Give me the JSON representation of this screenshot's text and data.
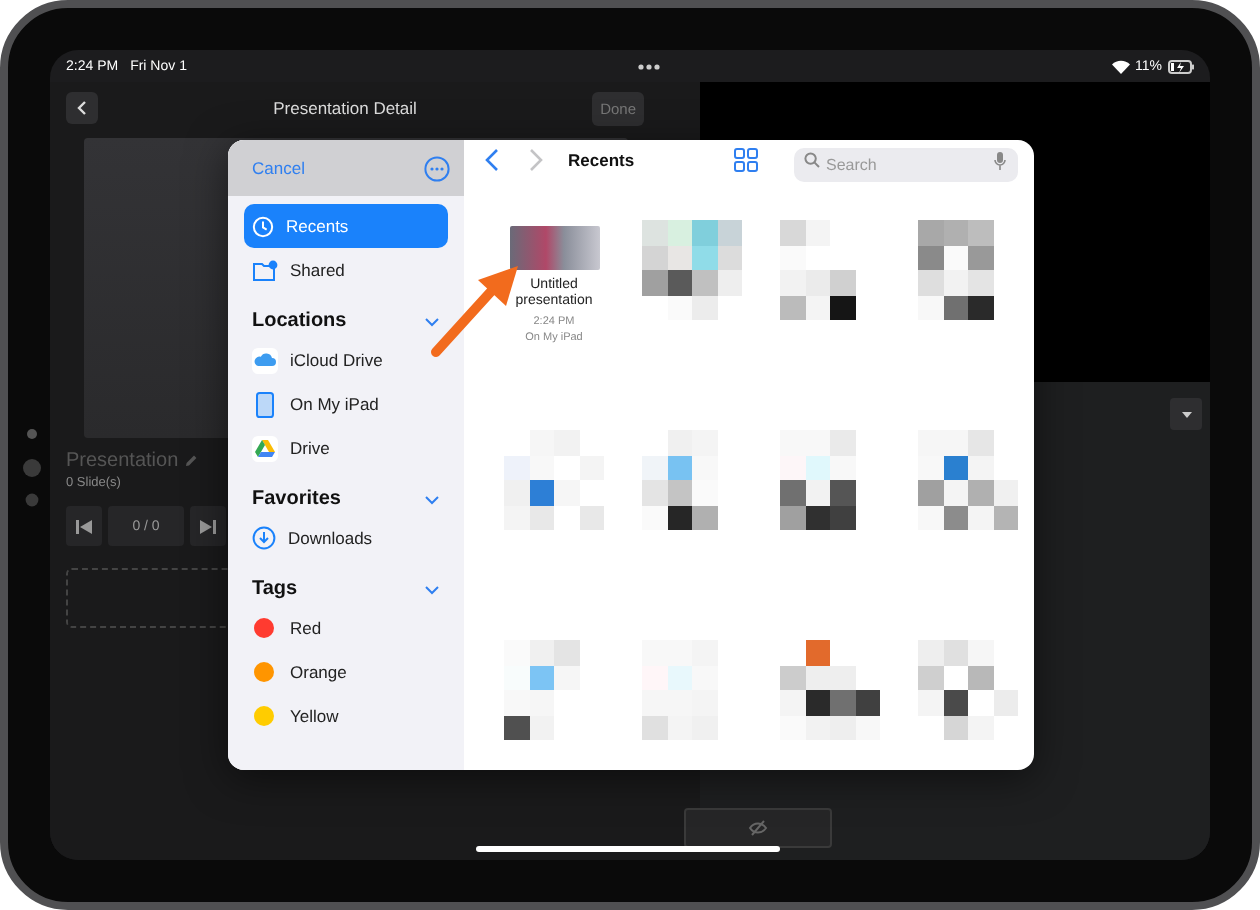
{
  "status_bar": {
    "time": "2:24 PM",
    "date": "Fri Nov 1",
    "battery": "11%"
  },
  "background_app": {
    "title": "Presentation Detail",
    "done_button": {
      "label": "Done",
      "disabled": true
    },
    "presentation_name": "Presentation",
    "slide_count": "0 Slide(s)",
    "slide_counter": "0 / 0"
  },
  "file_picker": {
    "cancel": "Cancel",
    "sidebar_top": [
      {
        "label": "Recents",
        "kind": "clock",
        "selected": true
      },
      {
        "label": "Shared",
        "kind": "shared",
        "selected": false
      }
    ],
    "sections": [
      {
        "title": "Locations",
        "expanded": true,
        "items": [
          {
            "label": "iCloud Drive",
            "kind": "icloud",
            "selected": false
          },
          {
            "label": "On My iPad",
            "kind": "ipad",
            "selected": false
          },
          {
            "label": "Drive",
            "kind": "drive",
            "selected": false
          }
        ]
      },
      {
        "title": "Favorites",
        "expanded": true,
        "items": [
          {
            "label": "Downloads",
            "kind": "downloads",
            "selected": false
          }
        ]
      },
      {
        "title": "Tags",
        "expanded": true,
        "items": [
          {
            "label": "Red",
            "kind": "tag",
            "color": "#ff3b30",
            "selected": false
          },
          {
            "label": "Orange",
            "kind": "tag",
            "color": "#ff9500",
            "selected": false
          },
          {
            "label": "Yellow",
            "kind": "tag",
            "color": "#ffcc00",
            "selected": false
          }
        ]
      }
    ],
    "title": "Recents",
    "back_disabled": false,
    "forward_disabled": true,
    "search": {
      "placeholder": "Search"
    },
    "files": [
      {
        "kind": "presentation",
        "name": "Untitled presentation",
        "time": "2:24 PM",
        "location": "On My iPad"
      },
      {
        "kind": "pixelated"
      },
      {
        "kind": "pixelated"
      },
      {
        "kind": "pixelated"
      },
      {
        "kind": "pixelated"
      },
      {
        "kind": "pixelated"
      },
      {
        "kind": "pixelated"
      },
      {
        "kind": "pixelated"
      },
      {
        "kind": "pixelated"
      },
      {
        "kind": "pixelated"
      },
      {
        "kind": "pixelated"
      },
      {
        "kind": "pixelated"
      }
    ]
  }
}
